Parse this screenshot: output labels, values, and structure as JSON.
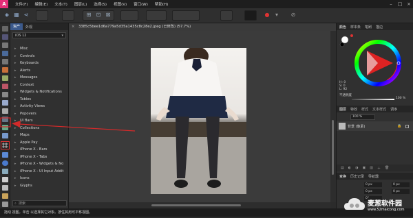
{
  "menubar": {
    "logo": "A",
    "items": [
      "文件(F)",
      "编辑(E)",
      "文本(T)",
      "图层(L)",
      "选择(S)",
      "视图(V)",
      "窗口(W)",
      "帮助(H)"
    ]
  },
  "assets": {
    "tabs": [
      "资产",
      "外观"
    ],
    "library": "iOS 12",
    "items": [
      "Misc",
      "Controls",
      "Keyboards",
      "Alerts",
      "Messages",
      "Context",
      "Widgets & Notifications",
      "Tables",
      "Activity Views",
      "Popovers",
      "UI Bars",
      "Collections",
      "Maps",
      "Apple Pay",
      "iPhone X - Bars",
      "iPhone X - Tabs",
      "iPhone X - Widgets & No",
      "iPhone X - UI Input Addit",
      "Icons",
      "Glyphs"
    ],
    "search_placeholder": "搜索"
  },
  "document": {
    "tab_title": "3385c5bee1d6a779a5d35a1435c8c28e2.jpeg (已修改) (57.7%)"
  },
  "right_panel": {
    "color_tabs": [
      "颜色",
      "样本条",
      "笔刷",
      "描边"
    ],
    "hsl": [
      "H: 0",
      "S: 0",
      "L: 92"
    ],
    "opacity_label": "不透明度",
    "opacity_value": "100 %",
    "layer_tabs": [
      "图层",
      "特效",
      "样式",
      "文本样式",
      "调序"
    ],
    "opacity_field": "100 %",
    "layer_name": "背景 (像素)",
    "history_tabs": [
      "变换",
      "历史记录",
      "导航器"
    ],
    "transform_fields": [
      "0 px",
      "0 px",
      "0 px",
      "0 px",
      "0°"
    ]
  },
  "status": {
    "text": "拖动 视图。单击 以选择其它对象。按住其用可平移视图。"
  },
  "watermark": {
    "title": "麦葱软件园",
    "url": "www.52maicong.com"
  },
  "colors": {
    "accent": "#3c5a8c",
    "logo": "#e62e78",
    "annotation": "#d42a2a"
  }
}
